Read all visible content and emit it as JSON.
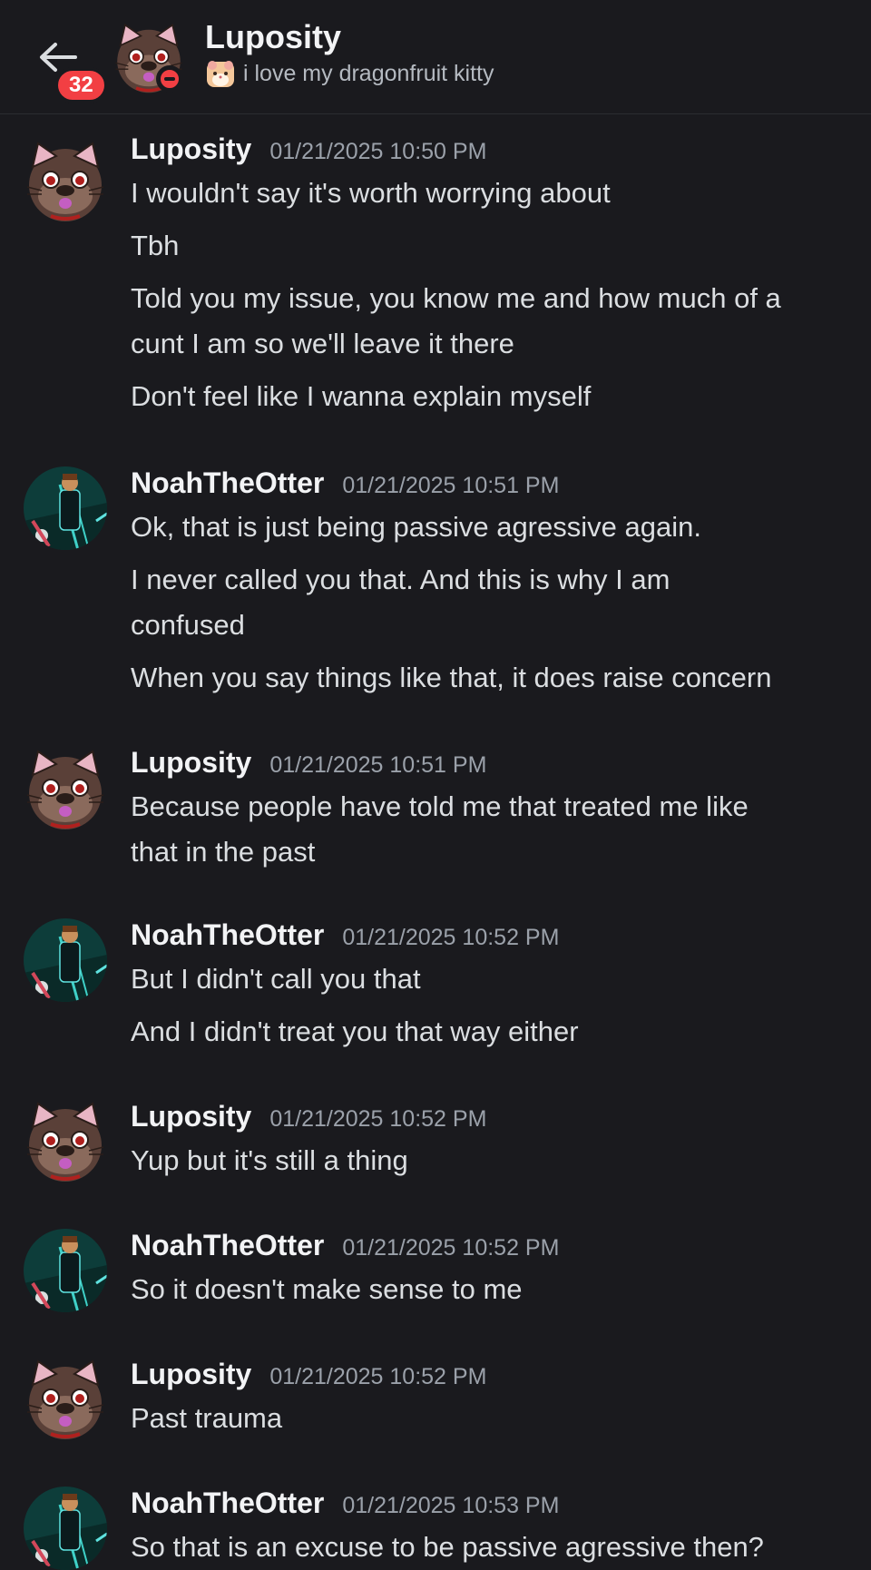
{
  "header": {
    "unread_badge": "32",
    "title": "Luposity",
    "custom_status": "i love my dragonfruit kitty",
    "status_emoji": "hamster-face-icon",
    "presence": "do-not-disturb"
  },
  "users": {
    "luposity": {
      "name": "Luposity",
      "avatar": "cat-avatar-icon"
    },
    "noah": {
      "name": "NoahTheOtter",
      "avatar": "otter-avatar-icon"
    }
  },
  "messages": [
    {
      "author": "Luposity",
      "timestamp": "01/21/2025 10:50 PM",
      "lines": [
        "I wouldn't say it's worth worrying about",
        "Tbh",
        "Told you my issue, you know me and how much of a",
        "cunt I am so we'll leave it there",
        "Don't feel like I wanna explain myself"
      ]
    },
    {
      "author": "NoahTheOtter",
      "timestamp": "01/21/2025 10:51 PM",
      "lines": [
        "Ok, that is just being passive agressive again.",
        "I never called you that. And this is why I am",
        "confused",
        "When you say things like that, it does raise concern"
      ]
    },
    {
      "author": "Luposity",
      "timestamp": "01/21/2025 10:51 PM",
      "lines": [
        "Because people have told me that treated me like",
        "that in the past"
      ]
    },
    {
      "author": "NoahTheOtter",
      "timestamp": "01/21/2025 10:52 PM",
      "lines": [
        "But I didn't call you that",
        "And I didn't treat you that way either"
      ]
    },
    {
      "author": "Luposity",
      "timestamp": "01/21/2025 10:52 PM",
      "lines": [
        "Yup but it's still a thing"
      ]
    },
    {
      "author": "NoahTheOtter",
      "timestamp": "01/21/2025 10:52 PM",
      "lines": [
        "So it doesn't make sense to me"
      ]
    },
    {
      "author": "Luposity",
      "timestamp": "01/21/2025 10:52 PM",
      "lines": [
        "Past trauma"
      ]
    },
    {
      "author": "NoahTheOtter",
      "timestamp": "01/21/2025 10:53 PM",
      "lines": [
        "So that is an excuse to be passive agressive then?"
      ]
    }
  ],
  "colors": {
    "background": "#1a1a1e",
    "badge": "#f23f43",
    "username": "#f2f3f5",
    "timestamp": "#9ba1aa",
    "message_text": "#dbdee1"
  }
}
